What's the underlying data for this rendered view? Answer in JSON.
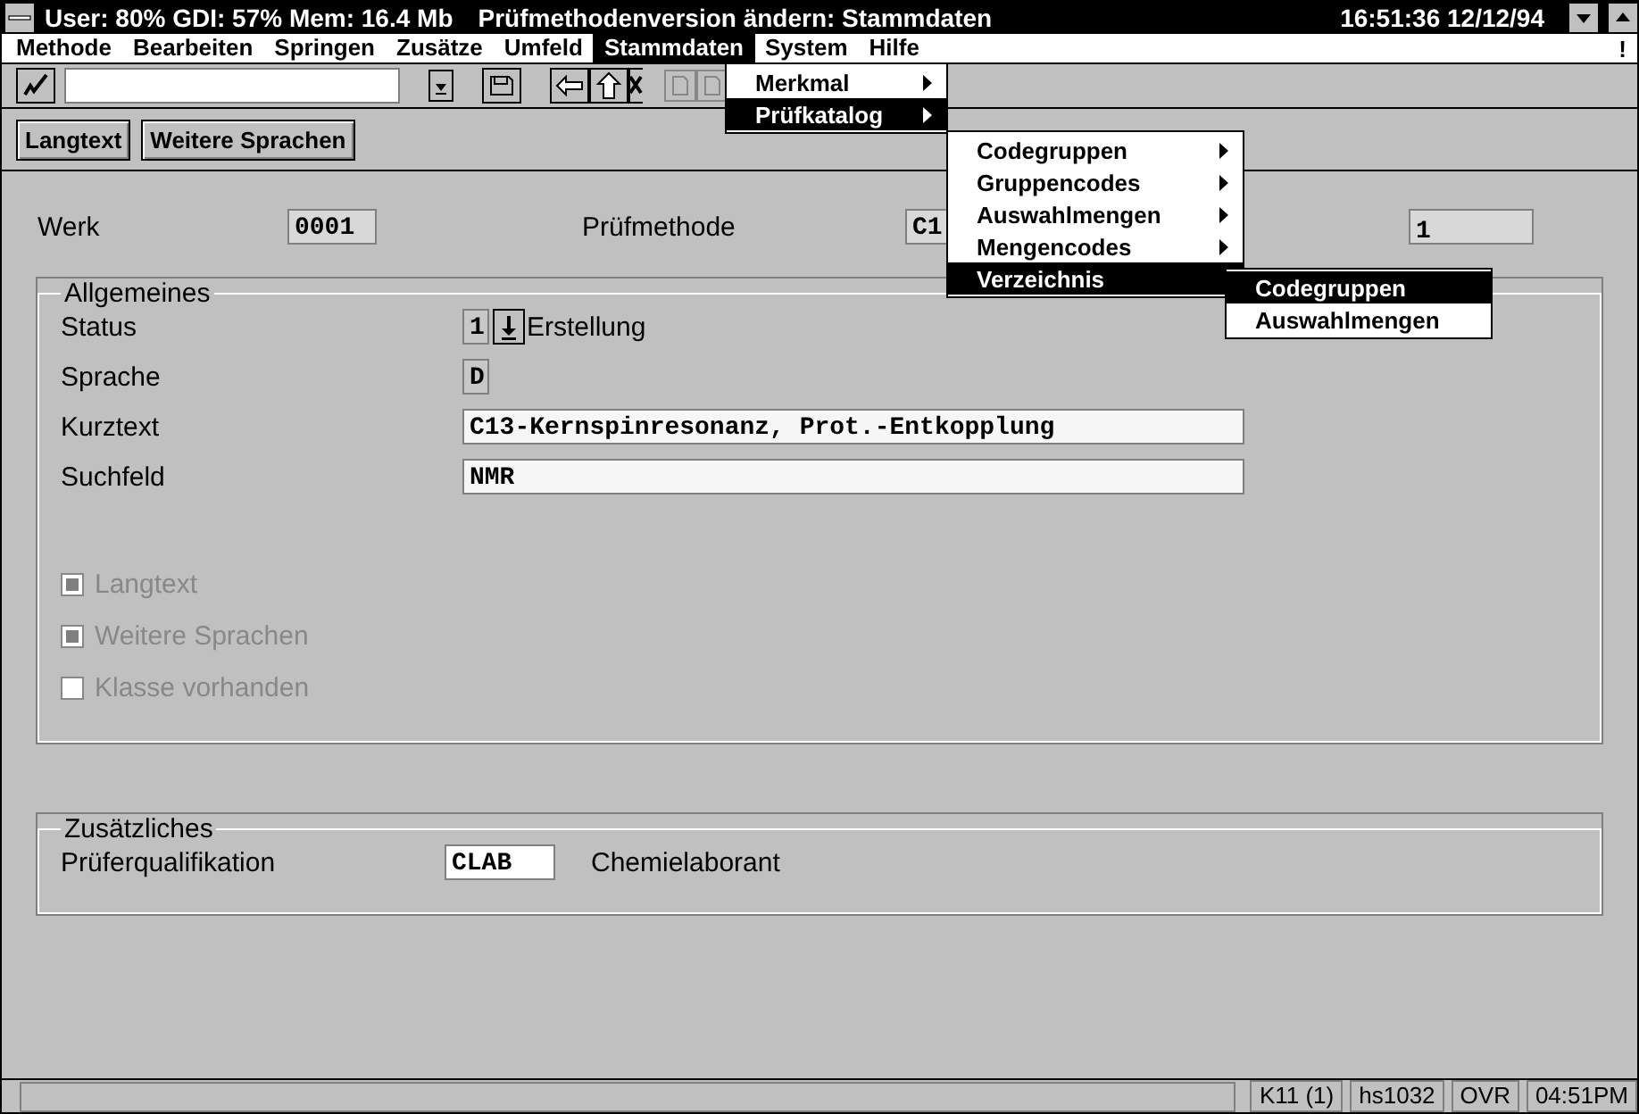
{
  "title_bar": {
    "system_info": "User: 80% GDI: 57%  Mem: 16.4 Mb",
    "title": "Prüfmethodenversion ändern: Stammdaten",
    "clock": "16:51:36  12/12/94"
  },
  "menubar": {
    "items": [
      {
        "label": "Methode",
        "selected": false
      },
      {
        "label": "Bearbeiten",
        "selected": false
      },
      {
        "label": "Springen",
        "selected": false
      },
      {
        "label": "Zusätze",
        "selected": false
      },
      {
        "label": "Umfeld",
        "selected": false
      },
      {
        "label": "Stammdaten",
        "selected": true
      },
      {
        "label": "System",
        "selected": false
      },
      {
        "label": "Hilfe",
        "selected": false
      }
    ],
    "help_mark": "!"
  },
  "open_menus": [
    {
      "items": [
        {
          "label": "Merkmal",
          "submenu": true,
          "selected": false
        },
        {
          "label": "Prüfkatalog",
          "submenu": true,
          "selected": true
        }
      ]
    },
    {
      "items": [
        {
          "label": "Codegruppen",
          "submenu": true,
          "selected": false
        },
        {
          "label": "Gruppencodes",
          "submenu": true,
          "selected": false
        },
        {
          "label": "Auswahlmengen",
          "submenu": true,
          "selected": false
        },
        {
          "label": "Mengencodes",
          "submenu": true,
          "selected": false
        },
        {
          "label": "Verzeichnis",
          "submenu": false,
          "selected": true
        }
      ]
    },
    {
      "items": [
        {
          "label": "Codegruppen",
          "submenu": false,
          "selected": true
        },
        {
          "label": "Auswahlmengen",
          "submenu": false,
          "selected": false
        }
      ]
    }
  ],
  "app_toolbar": {
    "buttons": [
      "Langtext",
      "Weitere Sprachen"
    ]
  },
  "header": {
    "werk": {
      "label": "Werk",
      "value": "0001"
    },
    "pruefmethode": {
      "label": "Prüfmethode",
      "value": "C1"
    },
    "field_3": {
      "value": "1"
    }
  },
  "allgemeines": {
    "title": "Allgemeines",
    "fields": [
      {
        "kind": "dropdown",
        "label": "Status",
        "value": "1",
        "text": "Erstellung"
      },
      {
        "kind": "readonly",
        "label": "Sprache",
        "value": "D"
      },
      {
        "kind": "input",
        "label": "Kurztext",
        "value": "C13-Kernspinresonanz, Prot.-Entkopplung"
      },
      {
        "kind": "input",
        "label": "Suchfeld",
        "value": "NMR"
      }
    ],
    "checkboxes": [
      {
        "label": "Langtext",
        "checked": true,
        "disabled": true
      },
      {
        "label": "Weitere Sprachen",
        "checked": true,
        "disabled": true
      },
      {
        "label": "Klasse vorhanden",
        "checked": false,
        "disabled": true
      }
    ]
  },
  "zusaetzliches": {
    "title": "Zusätzliches",
    "label": "Prüferqualifikation",
    "value": "CLAB",
    "text": "Chemielaborant"
  },
  "status_bar": {
    "segments": [
      "K11 (1)",
      "hs1032",
      "OVR",
      "04:51PM"
    ]
  }
}
